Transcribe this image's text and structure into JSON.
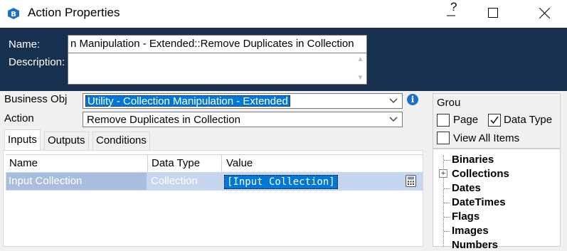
{
  "window": {
    "title": "Action Properties",
    "help_label": "?"
  },
  "header": {
    "name_label": "Name:",
    "name_value": "n Manipulation - Extended::Remove Duplicates in Collection",
    "description_label": "Description:",
    "description_value": ""
  },
  "form": {
    "business_obj_label": "Business Obj",
    "business_obj_value": "Utility - Collection Manipulation - Extended",
    "action_label": "Action",
    "action_value": "Remove Duplicates in Collection"
  },
  "tabs": [
    {
      "label": "Inputs",
      "active": true
    },
    {
      "label": "Outputs",
      "active": false
    },
    {
      "label": "Conditions",
      "active": false
    }
  ],
  "grid": {
    "columns": [
      "Name",
      "Data Type",
      "Value"
    ],
    "rows": [
      {
        "name": "Input Collection",
        "data_type": "Collection",
        "value": "[Input Collection]"
      }
    ]
  },
  "group": {
    "title": "Grou",
    "page_label": "Page",
    "page_checked": false,
    "data_type_label": "Data Type",
    "data_type_checked": true,
    "view_all_label": "View All Items",
    "view_all_checked": false
  },
  "tree": {
    "items": [
      {
        "label": "Binaries",
        "expandable": false
      },
      {
        "label": "Collections",
        "expandable": true
      },
      {
        "label": "Dates",
        "expandable": false
      },
      {
        "label": "DateTimes",
        "expandable": false
      },
      {
        "label": "Flags",
        "expandable": false
      },
      {
        "label": "Images",
        "expandable": false
      },
      {
        "label": "Numbers",
        "expandable": false
      }
    ]
  },
  "colors": {
    "header_bg": "#17304f",
    "selection": "#0078d7",
    "row_selected_bg": "#c6d6ee"
  }
}
